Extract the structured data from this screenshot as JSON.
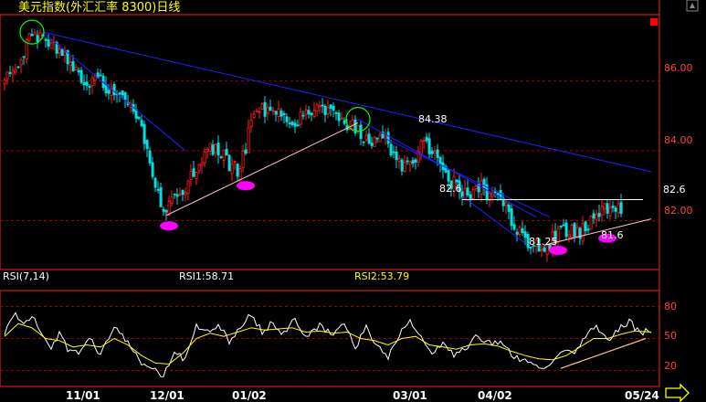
{
  "title": "美元指数(外汇汇率 8300)日线",
  "colors": {
    "up": "#ff2020",
    "down": "#00e0e0",
    "trend": "#2020ff",
    "support": "#ffc0c0",
    "marker": "#ff00ff",
    "circle": "#00ff00",
    "rsi1": "#ffffff",
    "rsi2": "#ffff00",
    "grid": "#a00000",
    "axis": "#ff2020"
  },
  "price_labels": [
    "86.00",
    "84.00",
    "82.00"
  ],
  "rsi_labels": [
    "80",
    "50",
    "20"
  ],
  "date_labels": [
    "11/01",
    "12/01",
    "01/02",
    "03/01",
    "04/02",
    "05/24"
  ],
  "annotations": {
    "peak": "84.38",
    "left_level": "82.6",
    "right_level": "82.6",
    "low": "81.25",
    "low2": "81.6"
  },
  "rsi_header": {
    "name": "RSI(7,14)",
    "rsi1": "RSI1:58.71",
    "rsi2": "RSI2:53.79"
  },
  "chart_data": [
    {
      "type": "candlestick",
      "title": "美元指数(外汇汇率 8300)日线",
      "ylim": [
        80.6,
        87.9
      ],
      "y_ticks": [
        86.0,
        84.0,
        82.0
      ],
      "x_tick_labels": [
        "11/01",
        "12/01",
        "01/02",
        "03/01",
        "04/02",
        "05/24"
      ],
      "close_anchors": [
        [
          0,
          85.9
        ],
        [
          5,
          86.6
        ],
        [
          10,
          87.3
        ],
        [
          14,
          87.4
        ],
        [
          17,
          87.0
        ],
        [
          22,
          86.8
        ],
        [
          26,
          86.3
        ],
        [
          30,
          86.0
        ],
        [
          35,
          86.0
        ],
        [
          40,
          85.6
        ],
        [
          45,
          85.3
        ],
        [
          50,
          84.6
        ],
        [
          54,
          83.4
        ],
        [
          57,
          82.5
        ],
        [
          59,
          82.2
        ],
        [
          62,
          82.6
        ],
        [
          66,
          83.0
        ],
        [
          70,
          83.6
        ],
        [
          75,
          84.0
        ],
        [
          78,
          84.0
        ],
        [
          82,
          83.6
        ],
        [
          86,
          83.4
        ],
        [
          89,
          84.5
        ],
        [
          93,
          85.2
        ],
        [
          98,
          85.2
        ],
        [
          102,
          85.0
        ],
        [
          106,
          84.9
        ],
        [
          110,
          85.0
        ],
        [
          115,
          85.3
        ],
        [
          120,
          85.1
        ],
        [
          124,
          84.9
        ],
        [
          128,
          84.6
        ],
        [
          131,
          84.4
        ],
        [
          134,
          84.3
        ],
        [
          138,
          84.5
        ],
        [
          142,
          83.9
        ],
        [
          145,
          83.5
        ],
        [
          149,
          83.8
        ],
        [
          153,
          84.2
        ],
        [
          158,
          83.8
        ],
        [
          162,
          83.2
        ],
        [
          166,
          82.9
        ],
        [
          170,
          82.6
        ],
        [
          173,
          83.0
        ],
        [
          176,
          82.8
        ],
        [
          180,
          82.6
        ],
        [
          183,
          82.3
        ],
        [
          186,
          81.8
        ],
        [
          190,
          81.4
        ],
        [
          194,
          81.3
        ],
        [
          198,
          81.3
        ],
        [
          202,
          81.6
        ],
        [
          206,
          81.8
        ],
        [
          210,
          81.6
        ],
        [
          214,
          82.0
        ],
        [
          218,
          82.3
        ],
        [
          222,
          82.2
        ],
        [
          225,
          82.4
        ]
      ],
      "trendlines": [
        {
          "from": [
            14,
            87.4
          ],
          "to": [
            236,
            83.4
          ]
        },
        {
          "from": [
            14,
            87.4
          ],
          "to": [
            66,
            84.0
          ]
        },
        {
          "from": [
            129,
            84.9
          ],
          "to": [
            194,
            82.1
          ]
        },
        {
          "from": [
            139,
            84.35
          ],
          "to": [
            199,
            82.1
          ]
        },
        {
          "from": [
            167,
            82.7
          ],
          "to": [
            190,
            81.35
          ]
        },
        {
          "from": [
            59,
            82.15
          ],
          "to": [
            129,
            84.8
          ]
        },
        {
          "from": [
            197,
            81.3
          ],
          "to": [
            236,
            82.05
          ]
        },
        {
          "from": [
            167,
            82.6
          ],
          "to": [
            233,
            82.6
          ]
        }
      ],
      "markers": [
        [
          60,
          81.85
        ],
        [
          88,
          83.0
        ],
        [
          202,
          81.15
        ],
        [
          220,
          81.5
        ]
      ],
      "circles": [
        [
          10,
          87.4
        ],
        [
          129,
          84.9
        ]
      ]
    },
    {
      "type": "line",
      "name": "RSI(7,14)",
      "ylim": [
        5,
        95
      ],
      "y_ticks": [
        80,
        50,
        20
      ],
      "series": [
        {
          "name": "RSI1",
          "anchors": [
            [
              0,
              55
            ],
            [
              4,
              74
            ],
            [
              7,
              64
            ],
            [
              10,
              72
            ],
            [
              13,
              55
            ],
            [
              17,
              42
            ],
            [
              20,
              55
            ],
            [
              23,
              40
            ],
            [
              27,
              35
            ],
            [
              31,
              50
            ],
            [
              35,
              35
            ],
            [
              40,
              62
            ],
            [
              45,
              45
            ],
            [
              50,
              28
            ],
            [
              54,
              22
            ],
            [
              58,
              14
            ],
            [
              62,
              38
            ],
            [
              66,
              30
            ],
            [
              70,
              62
            ],
            [
              74,
              56
            ],
            [
              78,
              64
            ],
            [
              82,
              46
            ],
            [
              86,
              62
            ],
            [
              90,
              72
            ],
            [
              94,
              56
            ],
            [
              98,
              65
            ],
            [
              102,
              54
            ],
            [
              106,
              70
            ],
            [
              110,
              50
            ],
            [
              115,
              62
            ],
            [
              120,
              52
            ],
            [
              124,
              65
            ],
            [
              128,
              40
            ],
            [
              132,
              62
            ],
            [
              136,
              42
            ],
            [
              140,
              33
            ],
            [
              144,
              54
            ],
            [
              148,
              66
            ],
            [
              152,
              50
            ],
            [
              156,
              33
            ],
            [
              160,
              47
            ],
            [
              164,
              35
            ],
            [
              168,
              40
            ],
            [
              172,
              52
            ],
            [
              176,
              45
            ],
            [
              180,
              47
            ],
            [
              184,
              38
            ],
            [
              188,
              30
            ],
            [
              192,
              28
            ],
            [
              196,
              22
            ],
            [
              200,
              26
            ],
            [
              204,
              40
            ],
            [
              208,
              36
            ],
            [
              212,
              52
            ],
            [
              216,
              62
            ],
            [
              220,
              48
            ],
            [
              224,
              58
            ],
            [
              228,
              66
            ],
            [
              232,
              55
            ],
            [
              236,
              58
            ]
          ]
        },
        {
          "name": "RSI2",
          "anchors": [
            [
              0,
              52
            ],
            [
              5,
              64
            ],
            [
              10,
              60
            ],
            [
              15,
              50
            ],
            [
              20,
              48
            ],
            [
              25,
              42
            ],
            [
              30,
              44
            ],
            [
              35,
              42
            ],
            [
              40,
              50
            ],
            [
              45,
              44
            ],
            [
              50,
              34
            ],
            [
              55,
              27
            ],
            [
              60,
              26
            ],
            [
              65,
              36
            ],
            [
              70,
              50
            ],
            [
              75,
              55
            ],
            [
              80,
              52
            ],
            [
              85,
              56
            ],
            [
              90,
              60
            ],
            [
              95,
              58
            ],
            [
              100,
              59
            ],
            [
              105,
              60
            ],
            [
              110,
              56
            ],
            [
              115,
              57
            ],
            [
              120,
              55
            ],
            [
              125,
              56
            ],
            [
              130,
              50
            ],
            [
              135,
              48
            ],
            [
              140,
              44
            ],
            [
              145,
              50
            ],
            [
              150,
              52
            ],
            [
              155,
              44
            ],
            [
              160,
              42
            ],
            [
              165,
              40
            ],
            [
              170,
              44
            ],
            [
              175,
              45
            ],
            [
              180,
              43
            ],
            [
              185,
              38
            ],
            [
              190,
              34
            ],
            [
              195,
              31
            ],
            [
              200,
              30
            ],
            [
              205,
              34
            ],
            [
              210,
              42
            ],
            [
              215,
              50
            ],
            [
              220,
              50
            ],
            [
              225,
              54
            ],
            [
              230,
              57
            ],
            [
              236,
              56
            ]
          ]
        }
      ],
      "trendlines": [
        {
          "from": [
            203,
            22
          ],
          "to": [
            234,
            50
          ]
        }
      ]
    }
  ]
}
